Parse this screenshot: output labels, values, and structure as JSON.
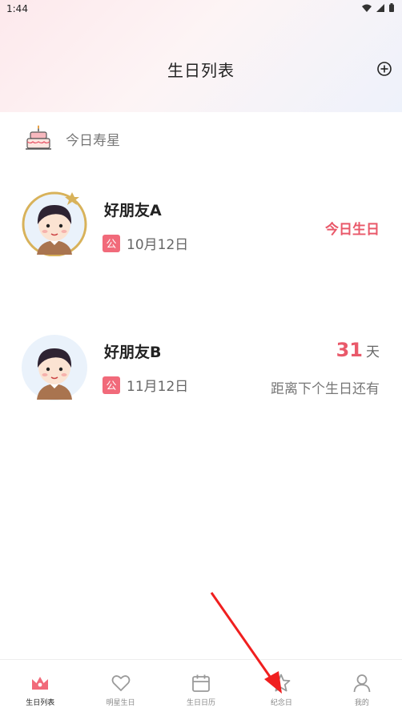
{
  "status_bar": {
    "time": "1:44"
  },
  "header": {
    "title": "生日列表"
  },
  "section": {
    "title": "今日寿星"
  },
  "friends": [
    {
      "name": "好朋友A",
      "badge": "公",
      "date": "10月12日",
      "status": "今日生日",
      "highlight": true
    },
    {
      "name": "好朋友B",
      "badge": "公",
      "date": "11月12日",
      "days": "31",
      "days_unit": "天",
      "countdown_label": "距离下个生日还有"
    }
  ],
  "nav": [
    {
      "label": "生日列表",
      "icon": "crown-icon",
      "active": true
    },
    {
      "label": "明星生日",
      "icon": "heart-icon"
    },
    {
      "label": "生日日历",
      "icon": "calendar-icon"
    },
    {
      "label": "纪念日",
      "icon": "star-icon"
    },
    {
      "label": "我的",
      "icon": "user-icon"
    }
  ],
  "colors": {
    "accent": "#e9596a",
    "badge": "#f16a7a",
    "gold_ring": "#d8b25a"
  }
}
